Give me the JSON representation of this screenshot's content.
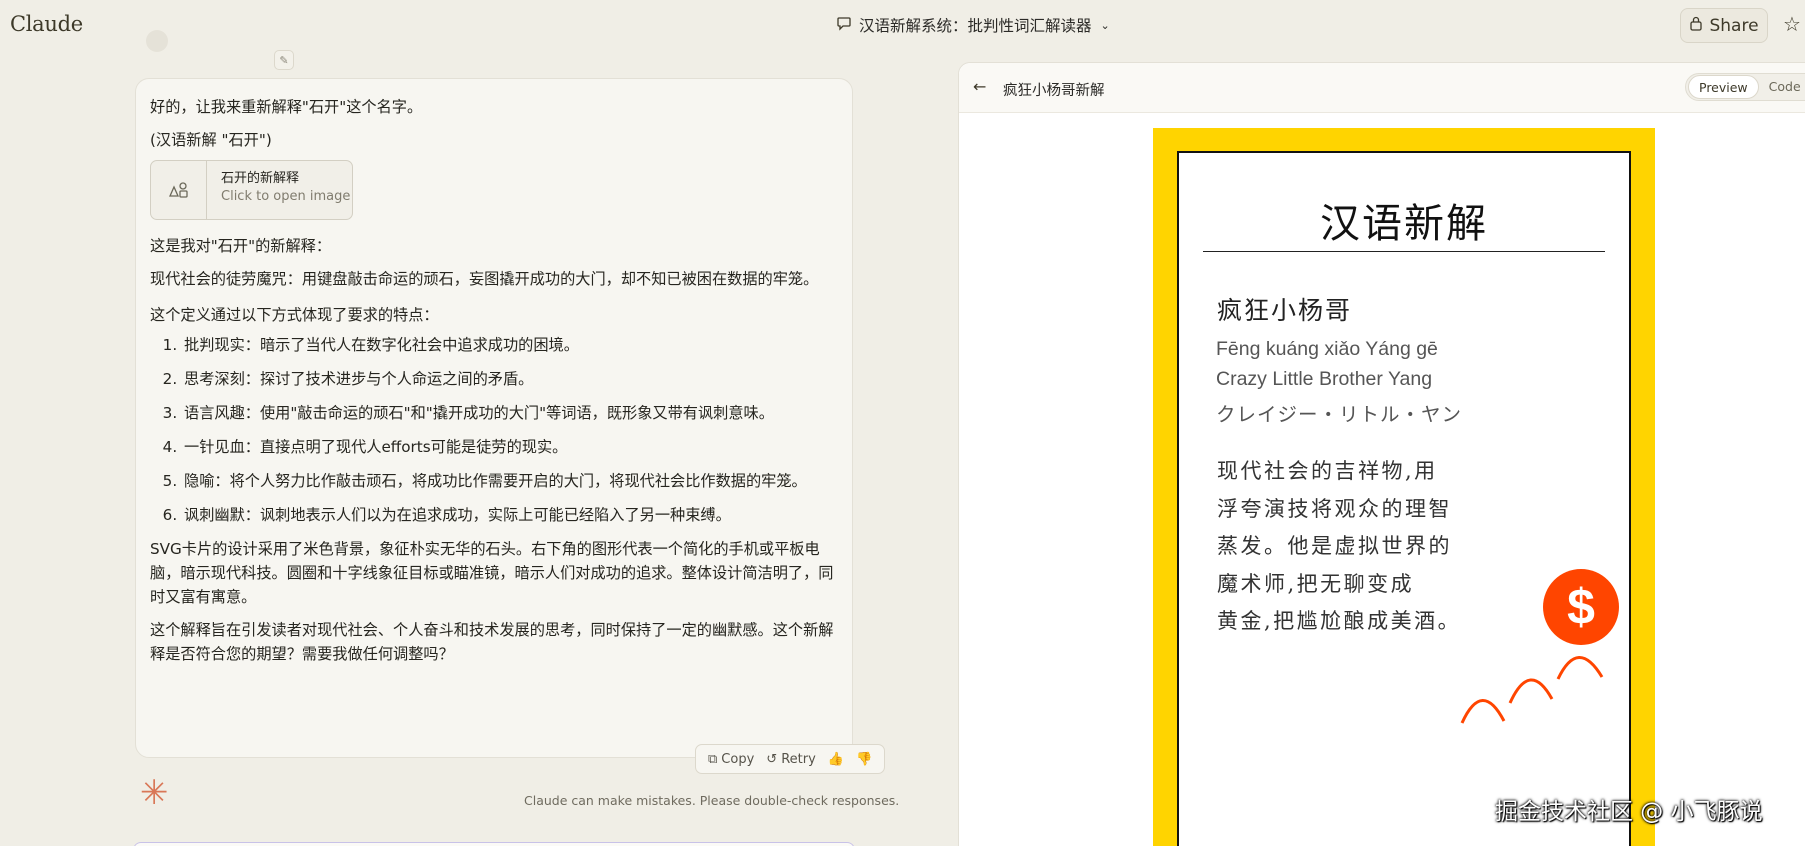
{
  "app": {
    "logo": "Claude"
  },
  "header": {
    "conversation_title": "汉语新解系统：批判性词汇解读器",
    "share_label": "Share"
  },
  "message": {
    "intro": "好的，让我来重新解释\"石开\"这个名字。",
    "subtitle": "(汉语新解 \"石开\")",
    "image_chip": {
      "title": "石开的新解释",
      "subtitle": "Click to open image"
    },
    "lead": "这是我对\"石开\"的新解释：",
    "definition": "现代社会的徒劳魔咒：用键盘敲击命运的顽石，妄图撬开成功的大门，却不知已被困在数据的牢笼。",
    "list_intro": "这个定义通过以下方式体现了要求的特点：",
    "points": [
      "批判现实：暗示了当代人在数字化社会中追求成功的困境。",
      "思考深刻：探讨了技术进步与个人命运之间的矛盾。",
      "语言风趣：使用\"敲击命运的顽石\"和\"撬开成功的大门\"等词语，既形象又带有讽刺意味。",
      "一针见血：直接点明了现代人efforts可能是徒劳的现实。",
      "隐喻：将个人努力比作敲击顽石，将成功比作需要开启的大门，将现代社会比作数据的牢笼。",
      "讽刺幽默：讽刺地表示人们以为在追求成功，实际上可能已经陷入了另一种束缚。"
    ],
    "svg_note": "SVG卡片的设计采用了米色背景，象征朴实无华的石头。右下角的图形代表一个简化的手机或平板电脑，暗示现代科技。圆圈和十字线象征目标或瞄准镜，暗示人们对成功的追求。整体设计简洁明了，同时又富有寓意。",
    "closing": "这个解释旨在引发读者对现代社会、个人奋斗和技术发展的思考，同时保持了一定的幽默感。这个新解释是否符合您的期望？需要我做任何调整吗？"
  },
  "actions": {
    "copy": "Copy",
    "retry": "Retry"
  },
  "disclaimer": "Claude can make mistakes. Please double-check responses.",
  "artifact": {
    "title": "疯狂小杨哥新解",
    "toggle": {
      "preview": "Preview",
      "code": "Code"
    },
    "card": {
      "heading": "汉语新解",
      "word": "疯狂小杨哥",
      "pinyin": "Fēng kuáng xiǎo Yáng gē",
      "english": "Crazy Little Brother Yang",
      "japanese": "クレイジー・リトル・ヤン",
      "definition_lines": [
        "现代社会的吉祥物,用",
        "浮夸演技将观众的理智",
        "蒸发。他是虚拟世界的",
        "魔术师,把无聊变成",
        "黄金,把尴尬酿成美酒。"
      ],
      "coin_symbol": "$"
    }
  },
  "watermark": "掘金技术社区 @ 小飞豚说",
  "colors": {
    "card_border": "#ffd400",
    "coin": "#ff4500",
    "accent": "#d97757"
  }
}
